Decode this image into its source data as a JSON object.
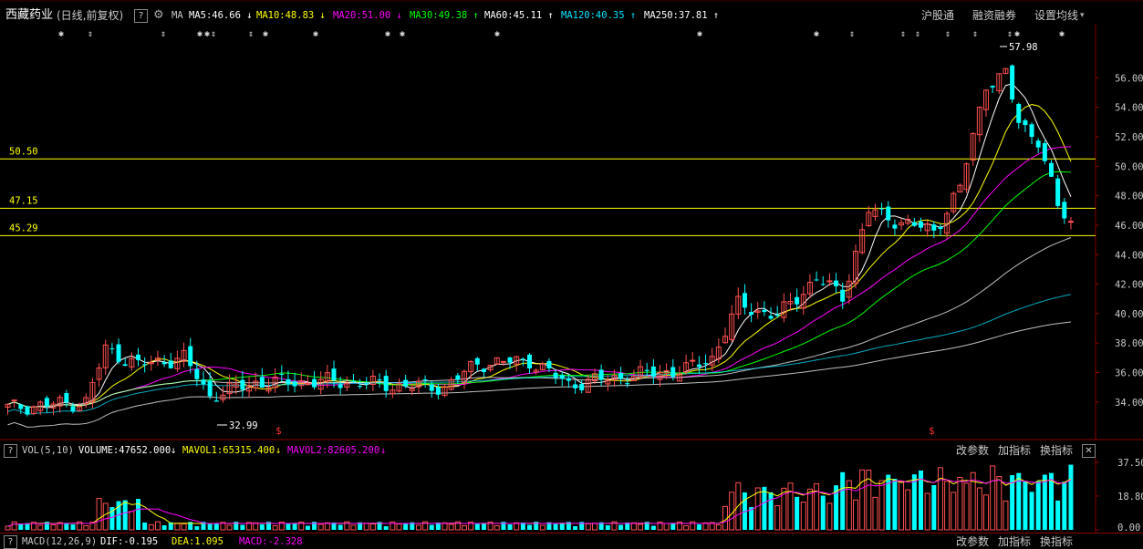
{
  "header": {
    "stock_name": "西藏药业",
    "period_label": "(日线,前复权)",
    "help_icon": "?",
    "ma_label": "MA",
    "ma_items": [
      {
        "label": "MA5:46.66",
        "arrow": "↓",
        "color": "#ffffff"
      },
      {
        "label": "MA10:48.83",
        "arrow": "↓",
        "color": "#ffff00"
      },
      {
        "label": "MA20:51.00",
        "arrow": "↓",
        "color": "#ff00ff"
      },
      {
        "label": "MA30:49.38",
        "arrow": "↑",
        "color": "#00ff00"
      },
      {
        "label": "MA60:45.11",
        "arrow": "↑",
        "color": "#ffffff"
      },
      {
        "label": "MA120:40.35",
        "arrow": "↑",
        "color": "#00e5ff"
      },
      {
        "label": "MA250:37.81",
        "arrow": "↑",
        "color": "#ffffff"
      }
    ],
    "right_links": [
      "沪股通",
      "融资融券",
      "设置均线"
    ]
  },
  "price_chart": {
    "hlines": [
      {
        "label": "50.50",
        "value": 50.5
      },
      {
        "label": "47.15",
        "value": 47.15
      },
      {
        "label": "45.29",
        "value": 45.29
      }
    ],
    "high_label": "57.98",
    "low_label": "32.99",
    "yticks": [
      "56.00",
      "54.00",
      "52.00",
      "50.00",
      "48.00",
      "46.00",
      "44.00",
      "42.00",
      "40.00",
      "38.00",
      "36.00",
      "34.00"
    ],
    "ylim": [
      33,
      58.5
    ]
  },
  "vol_panel": {
    "help_icon": "?",
    "title": "VOL(5,10)",
    "volume": "VOLUME:47652.000",
    "mavol1": "MAVOL1:65315.400",
    "mavol2": "MAVOL2:82605.200",
    "actions": [
      "改参数",
      "加指标",
      "换指标"
    ],
    "close": "✕",
    "yticks": [
      "37.50",
      "18.80",
      "0.00"
    ]
  },
  "macd_panel": {
    "help_icon": "?",
    "title": "MACD(12,26,9)",
    "dif": "DIF:-0.195",
    "dea": "DEA:1.095",
    "macd": "MACD:-2.328",
    "actions": [
      "改参数",
      "加指标",
      "换指标"
    ]
  },
  "colors": {
    "up": "#ff5050",
    "down": "#00ffff",
    "hline": "#ffff00",
    "grid": "#8b0000"
  }
}
